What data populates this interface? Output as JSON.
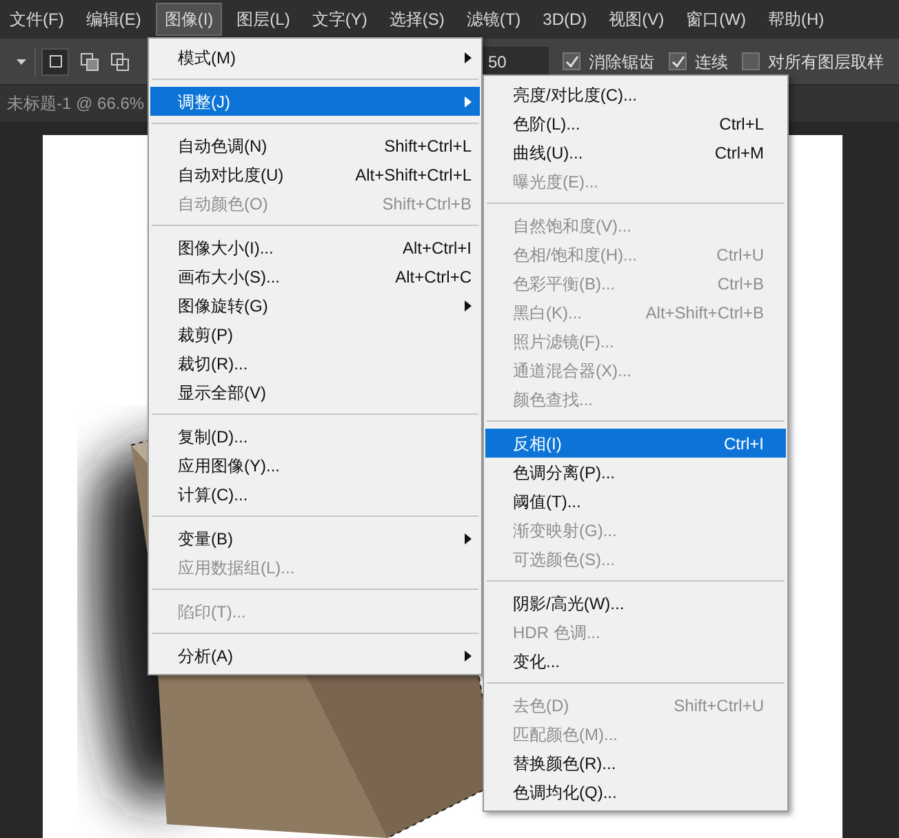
{
  "menubar": [
    {
      "label": "文件(F)",
      "selected": false
    },
    {
      "label": "编辑(E)",
      "selected": false
    },
    {
      "label": "图像(I)",
      "selected": true
    },
    {
      "label": "图层(L)",
      "selected": false
    },
    {
      "label": "文字(Y)",
      "selected": false
    },
    {
      "label": "选择(S)",
      "selected": false
    },
    {
      "label": "滤镜(T)",
      "selected": false
    },
    {
      "label": "3D(D)",
      "selected": false
    },
    {
      "label": "视图(V)",
      "selected": false
    },
    {
      "label": "窗口(W)",
      "selected": false
    },
    {
      "label": "帮助(H)",
      "selected": false
    }
  ],
  "options_bar": {
    "tolerance": "50",
    "checkboxes": [
      {
        "label": "消除锯齿",
        "checked": true
      },
      {
        "label": "连续",
        "checked": true
      },
      {
        "label": "对所有图层取样",
        "checked": false
      }
    ]
  },
  "document_tab": {
    "title": "未标题-1 @ 66.6%"
  },
  "image_menu": [
    {
      "kind": "item",
      "label": "模式(M)",
      "submenu": true,
      "disabled": false,
      "selected": false
    },
    {
      "kind": "separator"
    },
    {
      "kind": "item",
      "label": "调整(J)",
      "submenu": true,
      "disabled": false,
      "selected": true
    },
    {
      "kind": "separator"
    },
    {
      "kind": "item",
      "label": "自动色调(N)",
      "shortcut": "Shift+Ctrl+L",
      "disabled": false,
      "selected": false
    },
    {
      "kind": "item",
      "label": "自动对比度(U)",
      "shortcut": "Alt+Shift+Ctrl+L",
      "disabled": false,
      "selected": false
    },
    {
      "kind": "item",
      "label": "自动颜色(O)",
      "shortcut": "Shift+Ctrl+B",
      "disabled": true,
      "selected": false
    },
    {
      "kind": "separator"
    },
    {
      "kind": "item",
      "label": "图像大小(I)...",
      "shortcut": "Alt+Ctrl+I",
      "disabled": false,
      "selected": false
    },
    {
      "kind": "item",
      "label": "画布大小(S)...",
      "shortcut": "Alt+Ctrl+C",
      "disabled": false,
      "selected": false
    },
    {
      "kind": "item",
      "label": "图像旋转(G)",
      "submenu": true,
      "disabled": false,
      "selected": false
    },
    {
      "kind": "item",
      "label": "裁剪(P)",
      "disabled": false,
      "selected": false
    },
    {
      "kind": "item",
      "label": "裁切(R)...",
      "disabled": false,
      "selected": false
    },
    {
      "kind": "item",
      "label": "显示全部(V)",
      "disabled": false,
      "selected": false
    },
    {
      "kind": "separator"
    },
    {
      "kind": "item",
      "label": "复制(D)...",
      "disabled": false,
      "selected": false
    },
    {
      "kind": "item",
      "label": "应用图像(Y)...",
      "disabled": false,
      "selected": false
    },
    {
      "kind": "item",
      "label": "计算(C)...",
      "disabled": false,
      "selected": false
    },
    {
      "kind": "separator"
    },
    {
      "kind": "item",
      "label": "变量(B)",
      "submenu": true,
      "disabled": false,
      "selected": false
    },
    {
      "kind": "item",
      "label": "应用数据组(L)...",
      "disabled": true,
      "selected": false
    },
    {
      "kind": "separator"
    },
    {
      "kind": "item",
      "label": "陷印(T)...",
      "disabled": true,
      "selected": false
    },
    {
      "kind": "separator"
    },
    {
      "kind": "item",
      "label": "分析(A)",
      "submenu": true,
      "disabled": false,
      "selected": false
    }
  ],
  "adjust_submenu": [
    {
      "kind": "item",
      "label": "亮度/对比度(C)...",
      "disabled": false,
      "selected": false
    },
    {
      "kind": "item",
      "label": "色阶(L)...",
      "shortcut": "Ctrl+L",
      "disabled": false,
      "selected": false
    },
    {
      "kind": "item",
      "label": "曲线(U)...",
      "shortcut": "Ctrl+M",
      "disabled": false,
      "selected": false
    },
    {
      "kind": "item",
      "label": "曝光度(E)...",
      "disabled": true,
      "selected": false
    },
    {
      "kind": "separator"
    },
    {
      "kind": "item",
      "label": "自然饱和度(V)...",
      "disabled": true,
      "selected": false
    },
    {
      "kind": "item",
      "label": "色相/饱和度(H)...",
      "shortcut": "Ctrl+U",
      "disabled": true,
      "selected": false
    },
    {
      "kind": "item",
      "label": "色彩平衡(B)...",
      "shortcut": "Ctrl+B",
      "disabled": true,
      "selected": false
    },
    {
      "kind": "item",
      "label": "黑白(K)...",
      "shortcut": "Alt+Shift+Ctrl+B",
      "disabled": true,
      "selected": false
    },
    {
      "kind": "item",
      "label": "照片滤镜(F)...",
      "disabled": true,
      "selected": false
    },
    {
      "kind": "item",
      "label": "通道混合器(X)...",
      "disabled": true,
      "selected": false
    },
    {
      "kind": "item",
      "label": "颜色查找...",
      "disabled": true,
      "selected": false
    },
    {
      "kind": "separator"
    },
    {
      "kind": "item",
      "label": "反相(I)",
      "shortcut": "Ctrl+I",
      "disabled": false,
      "selected": true
    },
    {
      "kind": "item",
      "label": "色调分离(P)...",
      "disabled": false,
      "selected": false
    },
    {
      "kind": "item",
      "label": "阈值(T)...",
      "disabled": false,
      "selected": false
    },
    {
      "kind": "item",
      "label": "渐变映射(G)...",
      "disabled": true,
      "selected": false
    },
    {
      "kind": "item",
      "label": "可选颜色(S)...",
      "disabled": true,
      "selected": false
    },
    {
      "kind": "separator"
    },
    {
      "kind": "item",
      "label": "阴影/高光(W)...",
      "disabled": false,
      "selected": false
    },
    {
      "kind": "item",
      "label": "HDR 色调...",
      "disabled": true,
      "selected": false
    },
    {
      "kind": "item",
      "label": "变化...",
      "disabled": false,
      "selected": false
    },
    {
      "kind": "separator"
    },
    {
      "kind": "item",
      "label": "去色(D)",
      "shortcut": "Shift+Ctrl+U",
      "disabled": true,
      "selected": false
    },
    {
      "kind": "item",
      "label": "匹配颜色(M)...",
      "disabled": true,
      "selected": false
    },
    {
      "kind": "item",
      "label": "替换颜色(R)...",
      "disabled": false,
      "selected": false
    },
    {
      "kind": "item",
      "label": "色调均化(Q)...",
      "disabled": false,
      "selected": false
    }
  ]
}
